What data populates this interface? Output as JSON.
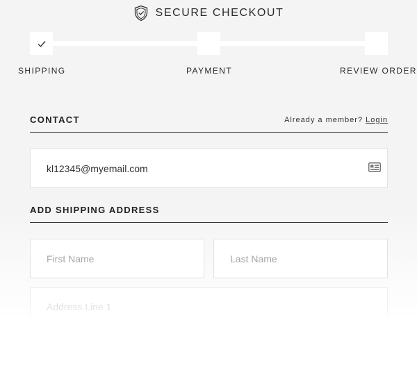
{
  "header": {
    "title": "SECURE CHECKOUT",
    "icon": "shield-check-icon"
  },
  "stepper": {
    "steps": [
      {
        "label": "SHIPPING",
        "completed": true
      },
      {
        "label": "PAYMENT",
        "completed": false
      },
      {
        "label": "REVIEW ORDER",
        "completed": false
      }
    ]
  },
  "contact": {
    "heading": "CONTACT",
    "member_text": "Already a member?",
    "login_label": "Login",
    "email_value": "kl12345@myemail.com",
    "email_icon": "contact-card-icon"
  },
  "shipping": {
    "heading": "ADD SHIPPING ADDRESS",
    "first_name_placeholder": "First Name",
    "last_name_placeholder": "Last Name",
    "address_line1_placeholder": "Address Line 1"
  }
}
